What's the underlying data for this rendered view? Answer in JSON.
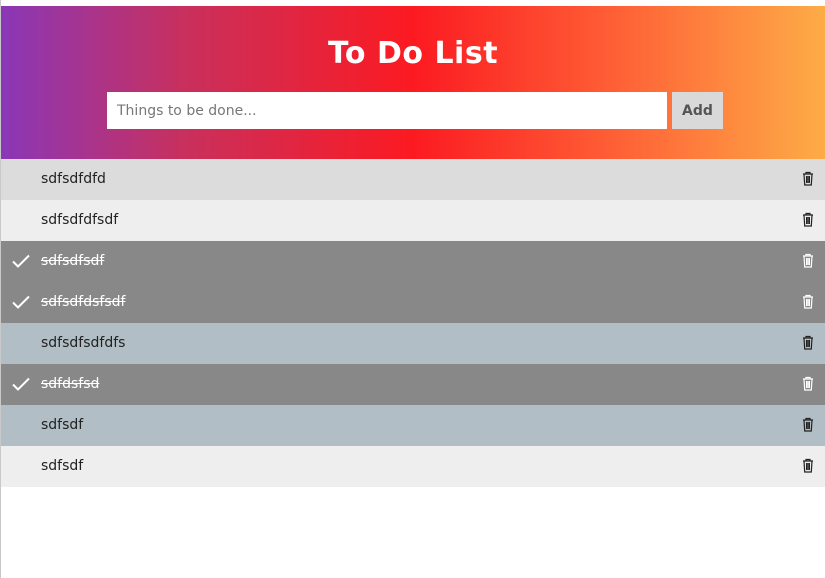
{
  "header": {
    "title": "To Do List",
    "input_placeholder": "Things to be done...",
    "add_label": "Add"
  },
  "todos": [
    {
      "text": "sdfsdfdfd",
      "checked": false
    },
    {
      "text": "sdfsdfdfsdf",
      "checked": false
    },
    {
      "text": "sdfsdfsdf",
      "checked": true
    },
    {
      "text": "sdfsdfdsfsdf",
      "checked": true
    },
    {
      "text": "sdfsdfsdfdfs",
      "checked": false
    },
    {
      "text": "sdfdsfsd",
      "checked": true
    },
    {
      "text": "sdfsdf",
      "checked": false
    },
    {
      "text": "sdfsdf",
      "checked": false
    }
  ],
  "colors": {
    "gradient": [
      "#8a37b7",
      "#fc1a21",
      "#fdac47"
    ],
    "checked_row": "#888888",
    "row_light": "#eeeeee",
    "row_mid": "#dcdcdc",
    "row_blue": "#b1bec5"
  },
  "icons": {
    "check": "check-icon",
    "delete": "trash-icon"
  }
}
